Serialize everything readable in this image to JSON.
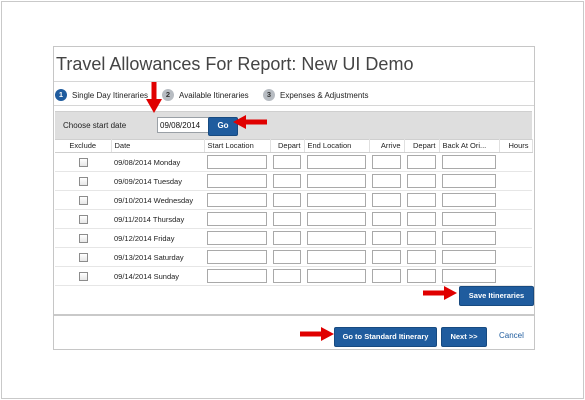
{
  "dialog": {
    "title": "Travel Allowances For Report: New UI Demo"
  },
  "steps": [
    {
      "num": "1",
      "label": "Single Day Itineraries",
      "active": true
    },
    {
      "num": "2",
      "label": "Available Itineraries",
      "active": false
    },
    {
      "num": "3",
      "label": "Expenses & Adjustments",
      "active": false
    }
  ],
  "datebar": {
    "label": "Choose start date",
    "value": "09/08/2014",
    "go_label": "Go"
  },
  "table": {
    "headers": {
      "exclude": "Exclude",
      "date": "Date",
      "start_location": "Start Location",
      "depart": "Depart",
      "end_location": "End Location",
      "arrive": "Arrive",
      "depart2": "Depart",
      "back_at": "Back At Ori...",
      "hours": "Hours"
    },
    "rows": [
      {
        "date": "09/08/2014 Monday"
      },
      {
        "date": "09/09/2014 Tuesday"
      },
      {
        "date": "09/10/2014 Wednesday"
      },
      {
        "date": "09/11/2014 Thursday"
      },
      {
        "date": "09/12/2014 Friday"
      },
      {
        "date": "09/13/2014 Saturday"
      },
      {
        "date": "09/14/2014 Sunday"
      }
    ]
  },
  "buttons": {
    "save": "Save Itineraries",
    "standard": "Go to Standard Itinerary",
    "next": "Next >>",
    "cancel": "Cancel"
  },
  "colors": {
    "primary": "#1f5c9e",
    "annotation_arrow": "#e00000"
  }
}
